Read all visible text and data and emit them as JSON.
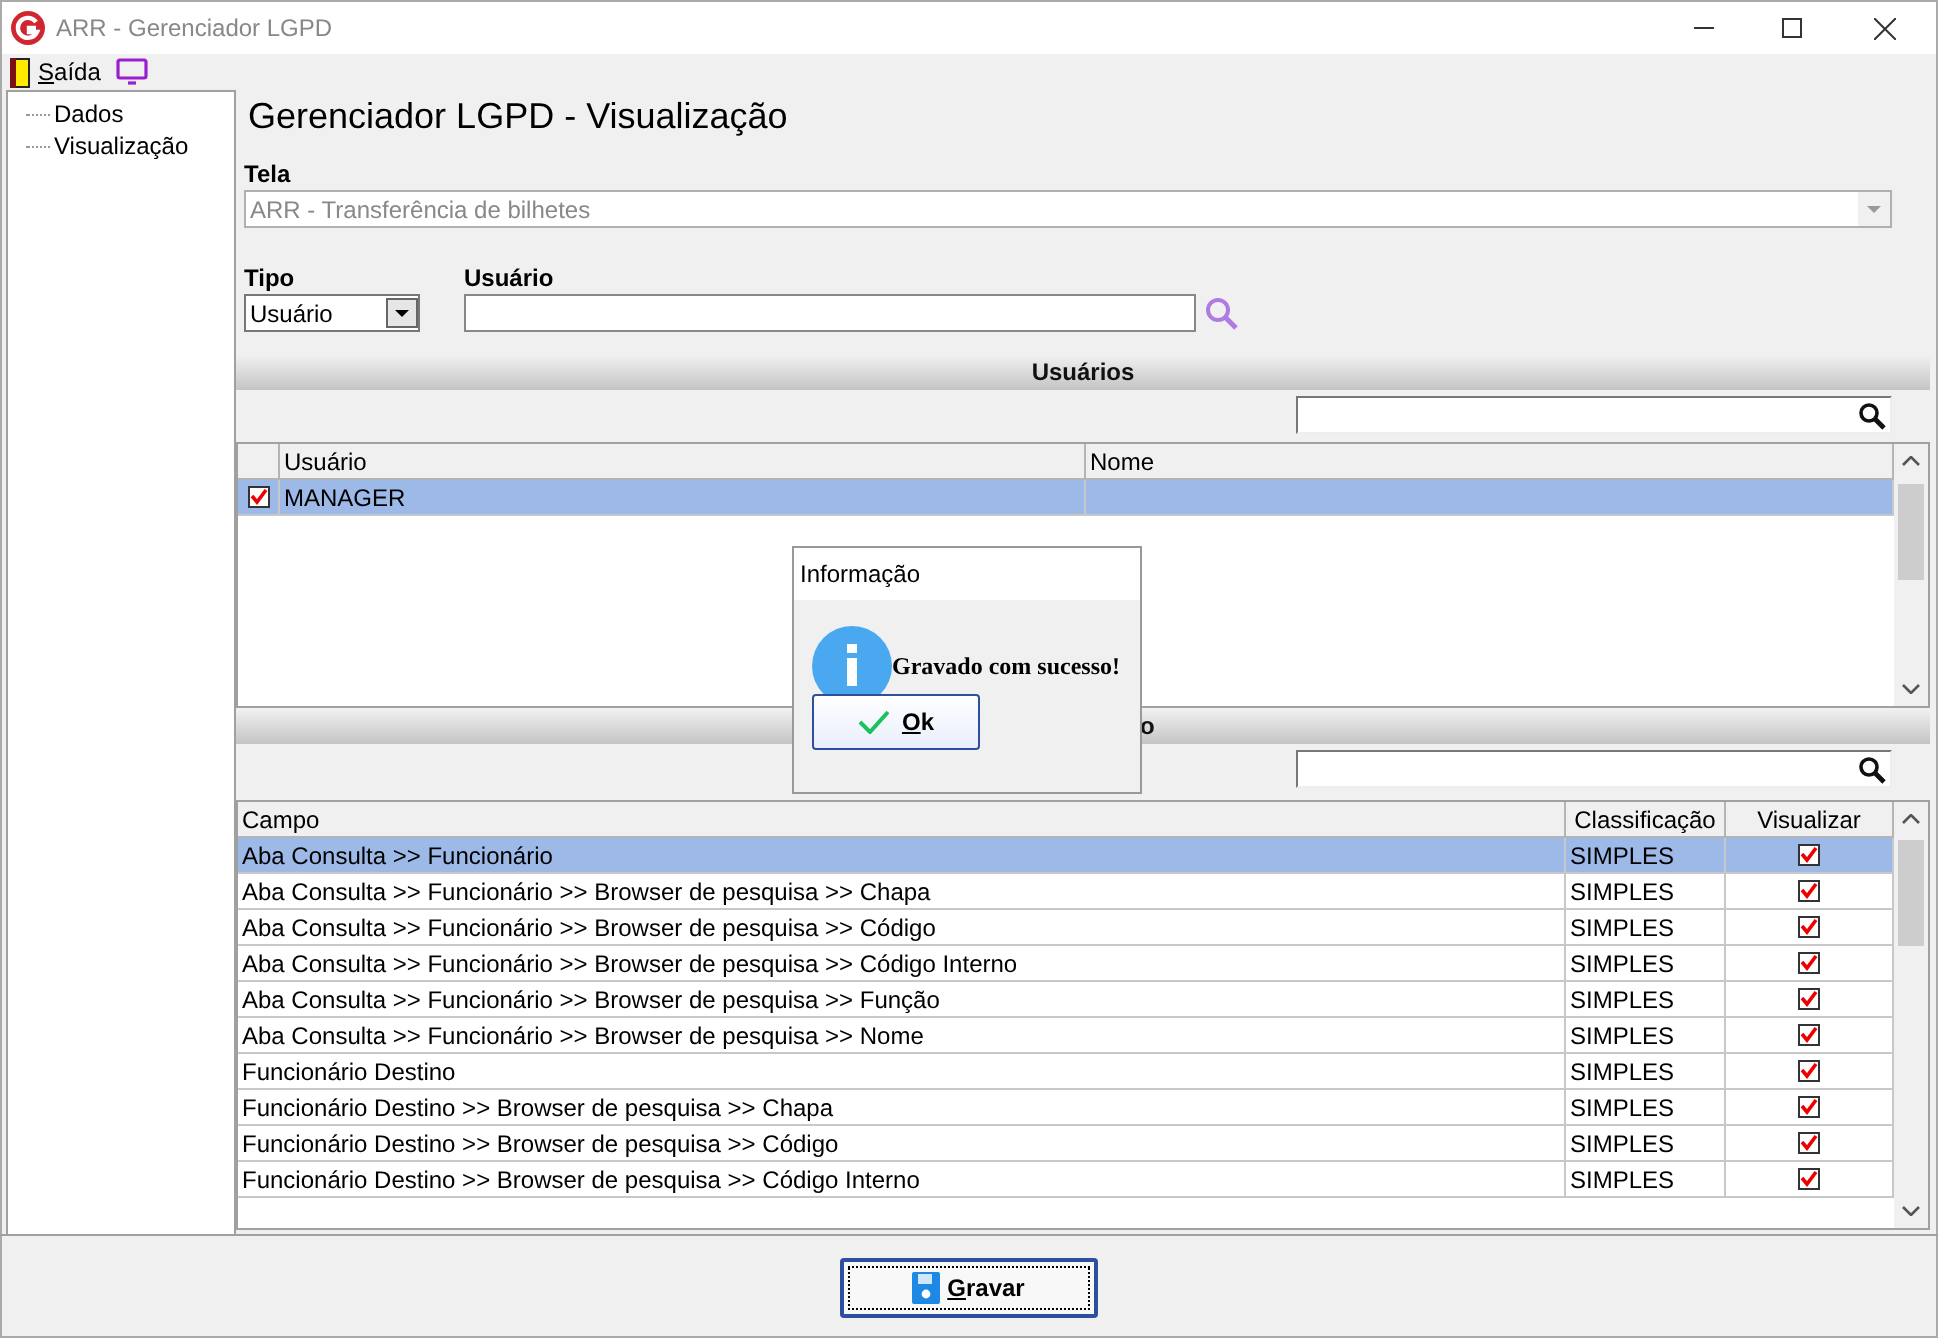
{
  "window": {
    "title": "ARR - Gerenciador LGPD"
  },
  "menu": [
    {
      "kind": "exit",
      "label": "Saída"
    },
    {
      "kind": "monitor"
    }
  ],
  "tree": [
    {
      "label": "Dados"
    },
    {
      "label": "Visualização"
    }
  ],
  "heading": "Gerenciador LGPD - Visualização",
  "tela": {
    "label": "Tela",
    "value": "ARR - Transferência de bilhetes",
    "disabled": true
  },
  "tipo": {
    "label": "Tipo",
    "value": "Usuário"
  },
  "usuario": {
    "label": "Usuário"
  },
  "users_section": {
    "title": "Usuários",
    "columns": [
      "Usuário",
      "Nome"
    ],
    "rows": [
      {
        "checked": true,
        "selected": true,
        "usuario": "MANAGER"
      }
    ]
  },
  "fields_section": {
    "title": "o",
    "columns": [
      "Campo",
      "Classificação",
      "Visualizar"
    ],
    "rows": [
      {
        "campo": "Aba Consulta >> Funcionário",
        "classificacao": "SIMPLES",
        "visualizar": true,
        "selected": true
      },
      {
        "campo": "Aba Consulta >> Funcionário >> Browser de pesquisa >> Chapa",
        "classificacao": "SIMPLES",
        "visualizar": true,
        "selected": false
      },
      {
        "campo": "Aba Consulta >> Funcionário >> Browser de pesquisa >> Código",
        "classificacao": "SIMPLES",
        "visualizar": true,
        "selected": false
      },
      {
        "campo": "Aba Consulta >> Funcionário >> Browser de pesquisa >> Código Interno",
        "classificacao": "SIMPLES",
        "visualizar": true,
        "selected": false
      },
      {
        "campo": "Aba Consulta >> Funcionário >> Browser de pesquisa >> Função",
        "classificacao": "SIMPLES",
        "visualizar": true,
        "selected": false
      },
      {
        "campo": "Aba Consulta >> Funcionário >> Browser de pesquisa >> Nome",
        "classificacao": "SIMPLES",
        "visualizar": true,
        "selected": false
      },
      {
        "campo": "Funcionário Destino",
        "classificacao": "SIMPLES",
        "visualizar": true,
        "selected": false
      },
      {
        "campo": "Funcionário Destino >> Browser de pesquisa >> Chapa",
        "classificacao": "SIMPLES",
        "visualizar": true,
        "selected": false
      },
      {
        "campo": "Funcionário Destino >> Browser de pesquisa >> Código",
        "classificacao": "SIMPLES",
        "visualizar": true,
        "selected": false
      },
      {
        "campo": "Funcionário Destino >> Browser de pesquisa >> Código Interno",
        "classificacao": "SIMPLES",
        "visualizar": true,
        "selected": false
      }
    ]
  },
  "dialog": {
    "title": "Informação",
    "message": "Gravado com sucesso!",
    "button": "Ok"
  },
  "save_button": "Gravar"
}
